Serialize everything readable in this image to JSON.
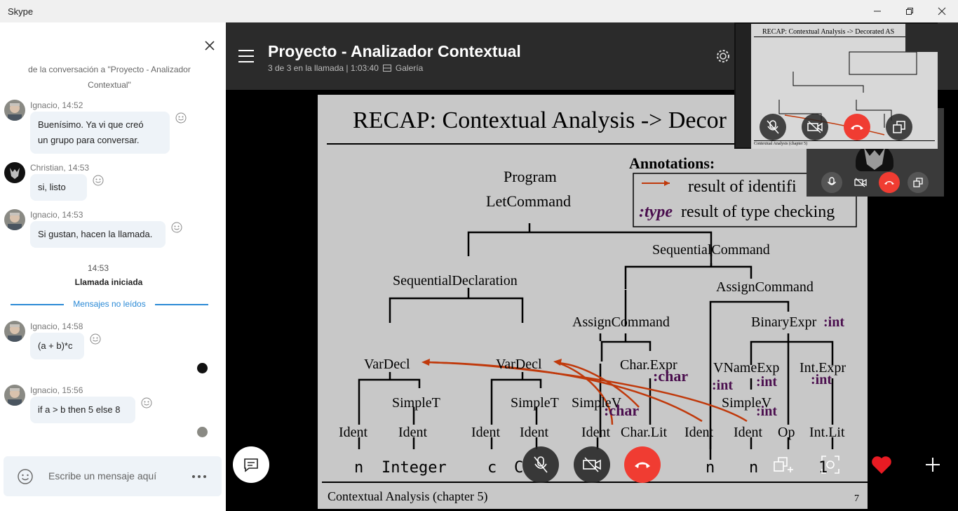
{
  "window": {
    "title": "Skype"
  },
  "chat": {
    "context_line": "de la conversación a \"Proyecto - Analizador Contextual\"",
    "messages": [
      {
        "author": "Ignacio, 14:52",
        "text_lines": [
          "Buenísimo.  Ya vi que creó",
          "un grupo para conversar."
        ]
      },
      {
        "author": "Christian, 14:53",
        "text_lines": [
          "si, listo"
        ]
      },
      {
        "author": "Ignacio, 14:53",
        "text_lines": [
          "Si gustan, hacen la llamada."
        ]
      },
      {
        "author": "Ignacio, 14:58",
        "text_lines": [
          "(a + b)*c"
        ]
      },
      {
        "author": "Ignacio, 15:56",
        "text_lines": [
          "if a > b then 5 else 8"
        ]
      }
    ],
    "call_event": {
      "time": "14:53",
      "label": "Llamada iniciada"
    },
    "unread_divider": "Mensajes no leídos",
    "composer_placeholder": "Escribe un mensaje aquí"
  },
  "call": {
    "title": "Proyecto - Analizador Contextual",
    "subtitle": "3 de 3 en la llamada | 1:03:40",
    "view_mode": "Galería",
    "colors": {
      "end_call": "#f03c32",
      "heart": "#e81b23",
      "header_bg": "#2b2b2b"
    }
  },
  "slide": {
    "title": "RECAP: Contextual Analysis -> Decor",
    "footer": "Contextual Analysis (chapter 5)",
    "page": "7",
    "annotations_title": "Annotations:",
    "annotation_identification": "result of identifi",
    "annotation_type_prefix": ":type",
    "annotation_type_text": "result of type checking",
    "nodes": {
      "program": "Program",
      "letcommand": "LetCommand",
      "seqdecl": "SequentialDeclaration",
      "seqcmd": "SequentialCommand",
      "assigncmd_r": "AssignCommand",
      "assigncmd_l": "AssignCommand",
      "binexpr": "BinaryExpr",
      "binexpr_type": ":int",
      "vardecl1": "VarDecl",
      "vardecl2": "VarDecl",
      "charexpr": "Char.Expr",
      "charexpr_type": ":char",
      "vnameexp": "VNameExp",
      "vnameexp_type1": ":int",
      "vnameexp_type2": ":int",
      "intexpr": "Int.Expr",
      "intexpr_type": ":int",
      "simplet1": "SimpleT",
      "simplet2": "SimpleT",
      "simplev1": "SimpleV",
      "simplev1_type": ":char",
      "simplev2": "SimpleV",
      "simplev2_type": ":int",
      "ident1": "Ident",
      "ident2": "Ident",
      "ident3": "Ident",
      "ident4": "Ident",
      "ident5": "Ident",
      "charlit": "Char.Lit",
      "ident6": "Ident",
      "ident7": "Ident",
      "op": "Op",
      "intlit": "Int.Lit"
    },
    "leaves": {
      "n1": "n",
      "integer": "Integer",
      "c": "c",
      "C": "C",
      "n2": "n",
      "n3": "n",
      "one": "1"
    }
  },
  "thumb": {
    "title": "RECAP: Contextual Analysis -> Decorated AS",
    "footer": "Contextual Analysis (chapter 5)"
  }
}
